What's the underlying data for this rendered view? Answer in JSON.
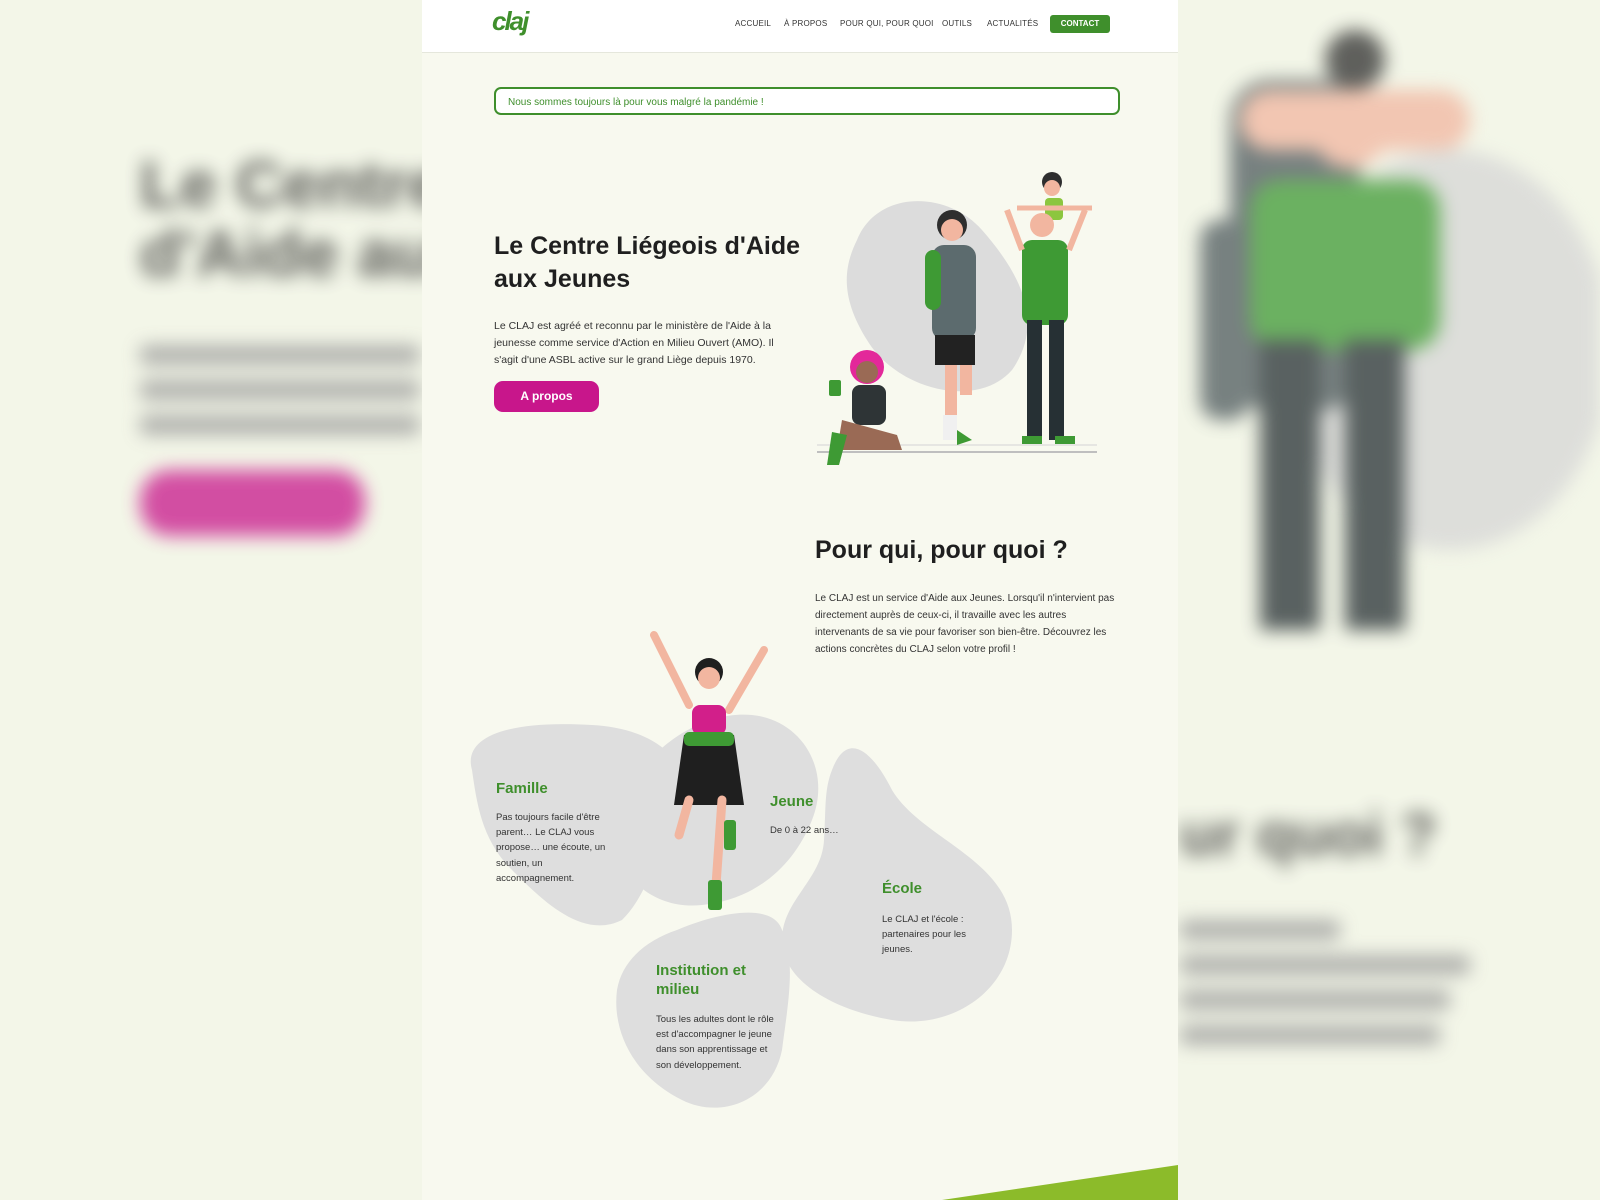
{
  "backdrop": {
    "left_title": [
      "Le Centre",
      "d'Aide aux"
    ],
    "right_title": "ur quoi ?"
  },
  "header": {
    "logo": "claj",
    "nav": [
      "ACCUEIL",
      "À PROPOS",
      "POUR QUI, POUR QUOI",
      "OUTILS",
      "ACTUALITÉS"
    ],
    "contact_label": "CONTACT"
  },
  "notice": "Nous sommes toujours là pour vous malgré la pandémie !",
  "hero": {
    "title": "Le Centre Liégeois d'Aide aux Jeunes",
    "text": "Le CLAJ est agréé et reconnu par le ministère de l'Aide à la jeunesse comme service d'Action en Milieu Ouvert (AMO). Il s'agit d'une ASBL active sur le grand Liège depuis 1970.",
    "button": "A propos"
  },
  "section2": {
    "title": "Pour qui, pour quoi ?",
    "text": "Le CLAJ est un service d'Aide aux Jeunes. Lorsqu'il n'intervient pas directement auprès de ceux-ci, il travaille avec les autres intervenants de sa vie pour favoriser son bien-être. Découvrez les actions concrètes du CLAJ selon votre profil !"
  },
  "profiles": {
    "famille": {
      "title": "Famille",
      "text": "Pas toujours facile d'être parent… Le CLAJ vous propose… une écoute, un soutien, un accompagnement."
    },
    "jeune": {
      "title": "Jeune",
      "text": "De 0 à 22 ans…"
    },
    "ecole": {
      "title": "École",
      "text": "Le CLAJ et l'école : partenaires pour les jeunes."
    },
    "institution": {
      "title": "Institution et milieu",
      "text": "Tous les adultes dont le rôle est d'accompagner le jeune dans son apprentissage et son développement."
    }
  },
  "colors": {
    "green": "#3f8f2c",
    "magenta": "#c8168b",
    "background": "#f8f9ef",
    "blob": "#dfdfdf"
  }
}
